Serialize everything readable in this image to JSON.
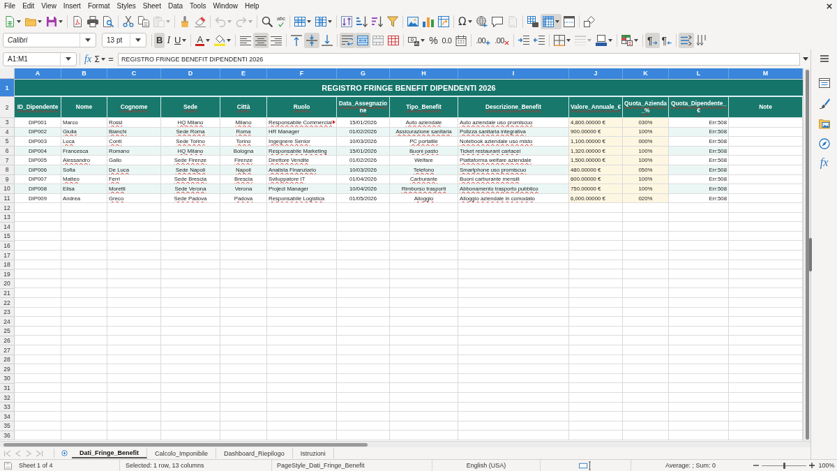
{
  "menu_bar": [
    "File",
    "Edit",
    "View",
    "Insert",
    "Format",
    "Styles",
    "Sheet",
    "Data",
    "Tools",
    "Window",
    "Help"
  ],
  "standard_toolbar": {
    "paste_disabled": true,
    "undo_disabled": true,
    "redo_disabled": true,
    "spelling_label": "abc",
    "special_character_label": "Ω",
    "header_footer_disabled": true,
    "freeze_rows_columns": true
  },
  "formatting_toolbar": {
    "font_name": "Calibri",
    "font_size": "13 pt",
    "bold": {
      "label": "B",
      "on": true
    },
    "italic": {
      "label": "I",
      "on": false
    },
    "underline": {
      "label": "U",
      "on": false
    },
    "font_color_label": "A",
    "align_left": false,
    "align_center": true,
    "align_right": false,
    "align_top": false,
    "align_middle": true,
    "align_bottom": false,
    "wrap_text": true,
    "merge_and_center": true,
    "percent_label": "%",
    "number_label": "0.0",
    "add_decimal_label": ".00",
    "delete_decimal_label": ".00",
    "border_style_disabled": true,
    "left_to_right": {
      "label": "¶",
      "on": true
    },
    "right_to_left": {
      "label": "¶",
      "on": false
    },
    "text_left_to_right": true,
    "text_top_to_bottom": false
  },
  "formula_bar": {
    "name_box": "A1:M1",
    "function_wizard_label": "fx",
    "sum_label": "Σ",
    "formula_label": "=",
    "value": "REGISTRO FRINGE BENEFIT DIPENDENTI 2026"
  },
  "sheet": {
    "column_headers": [
      {
        "label": "A",
        "selected": true
      },
      {
        "label": "B",
        "selected": true
      },
      {
        "label": "C",
        "selected": true
      },
      {
        "label": "D",
        "selected": true
      },
      {
        "label": "E",
        "selected": true
      },
      {
        "label": "F",
        "selected": true
      },
      {
        "label": "G",
        "selected": true
      },
      {
        "label": "H",
        "selected": true
      },
      {
        "label": "I",
        "selected": true
      },
      {
        "label": "J",
        "selected": true
      },
      {
        "label": "K",
        "selected": true
      },
      {
        "label": "L",
        "selected": true
      },
      {
        "label": "M",
        "selected": true
      }
    ],
    "row_headers": [
      {
        "label": "1",
        "selected": true
      },
      {
        "label": "2",
        "selected": false
      },
      {
        "label": "3",
        "selected": false
      },
      {
        "label": "4",
        "selected": false
      },
      {
        "label": "5",
        "selected": false
      },
      {
        "label": "6",
        "selected": false
      },
      {
        "label": "7",
        "selected": false
      },
      {
        "label": "8",
        "selected": false
      },
      {
        "label": "9",
        "selected": false
      },
      {
        "label": "10",
        "selected": false
      },
      {
        "label": "11",
        "selected": false
      },
      {
        "label": "12",
        "selected": false
      },
      {
        "label": "13",
        "selected": false
      },
      {
        "label": "14",
        "selected": false
      },
      {
        "label": "15",
        "selected": false
      },
      {
        "label": "16",
        "selected": false
      },
      {
        "label": "17",
        "selected": false
      },
      {
        "label": "18",
        "selected": false
      },
      {
        "label": "19",
        "selected": false
      },
      {
        "label": "20",
        "selected": false
      },
      {
        "label": "21",
        "selected": false
      },
      {
        "label": "22",
        "selected": false
      },
      {
        "label": "23",
        "selected": false
      },
      {
        "label": "24",
        "selected": false
      },
      {
        "label": "25",
        "selected": false
      },
      {
        "label": "26",
        "selected": false
      },
      {
        "label": "27",
        "selected": false
      },
      {
        "label": "28",
        "selected": false
      },
      {
        "label": "29",
        "selected": false
      },
      {
        "label": "30",
        "selected": false
      },
      {
        "label": "31",
        "selected": false
      },
      {
        "label": "32",
        "selected": false
      },
      {
        "label": "33",
        "selected": false
      },
      {
        "label": "34",
        "selected": false
      },
      {
        "label": "35",
        "selected": false
      },
      {
        "label": "36",
        "selected": false
      }
    ],
    "title": "REGISTRO FRINGE BENEFIT DIPENDENTI 2026",
    "header_row": [
      {
        "text": "ID_Dipendente",
        "misspelled": true
      },
      {
        "text": "Nome",
        "misspelled": false
      },
      {
        "text": "Cognome",
        "misspelled": true
      },
      {
        "text": "Sede",
        "misspelled": true
      },
      {
        "text": "Città",
        "misspelled": true
      },
      {
        "text": "Ruolo",
        "misspelled": true
      },
      {
        "text": "Data_Assegnazione",
        "misspelled": true
      },
      {
        "text": "Tipo_Benefit",
        "misspelled": true
      },
      {
        "text": "Descrizione_Benefit",
        "misspelled": true
      },
      {
        "text": "Valore_Annuale_€",
        "misspelled": true
      },
      {
        "text": "Quota_Azienda_%",
        "misspelled": true
      },
      {
        "text": "Quota_Dipendente_€",
        "misspelled": true
      },
      {
        "text": "Note",
        "misspelled": false
      }
    ],
    "data_rows": [
      [
        {
          "text": "DIP001",
          "misspelled": false,
          "clipped": false
        },
        {
          "text": "Marco",
          "misspelled": false,
          "clipped": false
        },
        {
          "text": "Rossi",
          "misspelled": true,
          "clipped": false
        },
        {
          "text": "HQ Milano",
          "misspelled": true,
          "clipped": false
        },
        {
          "text": "Milano",
          "misspelled": true,
          "clipped": false
        },
        {
          "text": "Responsabile Commercial",
          "misspelled": true,
          "clipped": true
        },
        {
          "text": "15/01/2026",
          "misspelled": false,
          "clipped": false
        },
        {
          "text": "Auto aziendale",
          "misspelled": true,
          "clipped": false
        },
        {
          "text": "Auto aziendale uso promiscuo",
          "misspelled": true,
          "clipped": false
        },
        {
          "text": "4,800.00000 €",
          "misspelled": false,
          "clipped": false
        },
        {
          "text": "030%",
          "misspelled": false,
          "clipped": false
        },
        {
          "text": "Err:508",
          "misspelled": false,
          "clipped": false
        }
      ],
      [
        {
          "text": "DIP002",
          "misspelled": false,
          "clipped": false
        },
        {
          "text": "Giulia",
          "misspelled": true,
          "clipped": false
        },
        {
          "text": "Bianchi",
          "misspelled": true,
          "clipped": false
        },
        {
          "text": "Sede Roma",
          "misspelled": true,
          "clipped": false
        },
        {
          "text": "Roma",
          "misspelled": true,
          "clipped": false
        },
        {
          "text": "HR Manager",
          "misspelled": false,
          "clipped": false
        },
        {
          "text": "01/02/2026",
          "misspelled": false,
          "clipped": false
        },
        {
          "text": "Assicurazione sanitaria",
          "misspelled": true,
          "clipped": false
        },
        {
          "text": "Polizza sanitaria integrativa",
          "misspelled": true,
          "clipped": false
        },
        {
          "text": "900.00000 €",
          "misspelled": false,
          "clipped": false
        },
        {
          "text": "100%",
          "misspelled": false,
          "clipped": false
        },
        {
          "text": "Err:508",
          "misspelled": false,
          "clipped": false
        }
      ],
      [
        {
          "text": "DIP003",
          "misspelled": false,
          "clipped": false
        },
        {
          "text": "Luca",
          "misspelled": true,
          "clipped": false
        },
        {
          "text": "Conti",
          "misspelled": true,
          "clipped": false
        },
        {
          "text": "Sede Torino",
          "misspelled": true,
          "clipped": false
        },
        {
          "text": "Torino",
          "misspelled": true,
          "clipped": false
        },
        {
          "text": "Ingegnere Senior",
          "misspelled": true,
          "clipped": false
        },
        {
          "text": "10/03/2026",
          "misspelled": false,
          "clipped": false
        },
        {
          "text": "PC portatile",
          "misspelled": true,
          "clipped": false
        },
        {
          "text": "Notebook aziendale uso misto",
          "misspelled": true,
          "clipped": false
        },
        {
          "text": "1,100.00000 €",
          "misspelled": false,
          "clipped": false
        },
        {
          "text": "000%",
          "misspelled": false,
          "clipped": false
        },
        {
          "text": "Err:508",
          "misspelled": false,
          "clipped": false
        }
      ],
      [
        {
          "text": "DIP004",
          "misspelled": false,
          "clipped": false
        },
        {
          "text": "Francesca",
          "misspelled": false,
          "clipped": false
        },
        {
          "text": "Romano",
          "misspelled": false,
          "clipped": false
        },
        {
          "text": "HQ Milano",
          "misspelled": true,
          "clipped": false
        },
        {
          "text": "Bologna",
          "misspelled": false,
          "clipped": false
        },
        {
          "text": "Responsabile Marketing",
          "misspelled": true,
          "clipped": false
        },
        {
          "text": "15/01/2026",
          "misspelled": false,
          "clipped": false
        },
        {
          "text": "Buoni pasto",
          "misspelled": true,
          "clipped": false
        },
        {
          "text": "Ticket restaurant cartacei",
          "misspelled": true,
          "clipped": false
        },
        {
          "text": "1,320.00000 €",
          "misspelled": false,
          "clipped": false
        },
        {
          "text": "100%",
          "misspelled": false,
          "clipped": false
        },
        {
          "text": "Err:508",
          "misspelled": false,
          "clipped": false
        }
      ],
      [
        {
          "text": "DIP005",
          "misspelled": false,
          "clipped": false
        },
        {
          "text": "Alessandro",
          "misspelled": true,
          "clipped": false
        },
        {
          "text": "Gallo",
          "misspelled": false,
          "clipped": false
        },
        {
          "text": "Sede Firenze",
          "misspelled": true,
          "clipped": false
        },
        {
          "text": "Firenze",
          "misspelled": true,
          "clipped": false
        },
        {
          "text": "Direttore Vendite",
          "misspelled": true,
          "clipped": false
        },
        {
          "text": "01/02/2026",
          "misspelled": false,
          "clipped": false
        },
        {
          "text": "Welfare",
          "misspelled": false,
          "clipped": false
        },
        {
          "text": "Piattaforma welfare aziendale",
          "misspelled": true,
          "clipped": false
        },
        {
          "text": "1,500.00000 €",
          "misspelled": false,
          "clipped": false
        },
        {
          "text": "100%",
          "misspelled": false,
          "clipped": false
        },
        {
          "text": "Err:508",
          "misspelled": false,
          "clipped": false
        }
      ],
      [
        {
          "text": "DIP006",
          "misspelled": false,
          "clipped": false
        },
        {
          "text": "Sofia",
          "misspelled": false,
          "clipped": false
        },
        {
          "text": "De Luca",
          "misspelled": true,
          "clipped": false
        },
        {
          "text": "Sede Napoli",
          "misspelled": true,
          "clipped": false
        },
        {
          "text": "Napoli",
          "misspelled": true,
          "clipped": false
        },
        {
          "text": "Analista Finanziario",
          "misspelled": true,
          "clipped": false
        },
        {
          "text": "10/03/2026",
          "misspelled": false,
          "clipped": false
        },
        {
          "text": "Telefono",
          "misspelled": true,
          "clipped": false
        },
        {
          "text": "Smartphone uso promiscuo",
          "misspelled": true,
          "clipped": false
        },
        {
          "text": "480.00000 €",
          "misspelled": false,
          "clipped": false
        },
        {
          "text": "050%",
          "misspelled": false,
          "clipped": false
        },
        {
          "text": "Err:508",
          "misspelled": false,
          "clipped": false
        }
      ],
      [
        {
          "text": "DIP007",
          "misspelled": false,
          "clipped": false
        },
        {
          "text": "Matteo",
          "misspelled": true,
          "clipped": false
        },
        {
          "text": "Ferri",
          "misspelled": true,
          "clipped": false
        },
        {
          "text": "Sede Brescia",
          "misspelled": true,
          "clipped": false
        },
        {
          "text": "Brescia",
          "misspelled": true,
          "clipped": false
        },
        {
          "text": "Sviluppatore IT",
          "misspelled": true,
          "clipped": false
        },
        {
          "text": "01/04/2026",
          "misspelled": false,
          "clipped": false
        },
        {
          "text": "Carburante",
          "misspelled": true,
          "clipped": false
        },
        {
          "text": "Buoni carburante mensili",
          "misspelled": true,
          "clipped": false
        },
        {
          "text": "600.00000 €",
          "misspelled": false,
          "clipped": false
        },
        {
          "text": "100%",
          "misspelled": false,
          "clipped": false
        },
        {
          "text": "Err:508",
          "misspelled": false,
          "clipped": false
        }
      ],
      [
        {
          "text": "DIP008",
          "misspelled": false,
          "clipped": false
        },
        {
          "text": "Elisa",
          "misspelled": false,
          "clipped": false
        },
        {
          "text": "Moretti",
          "misspelled": true,
          "clipped": false
        },
        {
          "text": "Sede Verona",
          "misspelled": true,
          "clipped": false
        },
        {
          "text": "Verona",
          "misspelled": false,
          "clipped": false
        },
        {
          "text": "Project Manager",
          "misspelled": false,
          "clipped": false
        },
        {
          "text": "10/04/2026",
          "misspelled": false,
          "clipped": false
        },
        {
          "text": "Rimborso trasporti",
          "misspelled": true,
          "clipped": false
        },
        {
          "text": "Abbonamento trasporto pubblico",
          "misspelled": true,
          "clipped": false
        },
        {
          "text": "750.00000 €",
          "misspelled": false,
          "clipped": false
        },
        {
          "text": "100%",
          "misspelled": false,
          "clipped": false
        },
        {
          "text": "Err:508",
          "misspelled": false,
          "clipped": false
        }
      ],
      [
        {
          "text": "DIP009",
          "misspelled": false,
          "clipped": false
        },
        {
          "text": "Andrea",
          "misspelled": false,
          "clipped": false
        },
        {
          "text": "Greco",
          "misspelled": true,
          "clipped": false
        },
        {
          "text": "Sede Padova",
          "misspelled": true,
          "clipped": false
        },
        {
          "text": "Padova",
          "misspelled": true,
          "clipped": false
        },
        {
          "text": "Responsabile Logistica",
          "misspelled": true,
          "clipped": false
        },
        {
          "text": "01/05/2026",
          "misspelled": false,
          "clipped": false
        },
        {
          "text": "Alloggio",
          "misspelled": true,
          "clipped": false
        },
        {
          "text": "Alloggio aziendale in comodato",
          "misspelled": true,
          "clipped": false
        },
        {
          "text": "6,000.00000 €",
          "misspelled": false,
          "clipped": false
        },
        {
          "text": "020%",
          "misspelled": false,
          "clipped": false
        },
        {
          "text": "Err:508",
          "misspelled": false,
          "clipped": false
        }
      ]
    ]
  },
  "sheet_tabs": [
    {
      "label": "Dati_Fringe_Benefit",
      "selected": true
    },
    {
      "label": "Calcolo_Imponibile",
      "selected": false
    },
    {
      "label": "Dashboard_Riepilogo",
      "selected": false
    },
    {
      "label": "Istruzioni",
      "selected": false
    }
  ],
  "sidebar": {
    "functions_label": "fx"
  },
  "status_bar": {
    "sheet": "Sheet 1 of 4",
    "selection": "Selected: 1 row, 13 columns",
    "page_style": "PageStyle_Dati_Fringe_Benefit",
    "language": "English (USA)",
    "summary": "Average: ; Sum: 0",
    "zoom": {
      "level": 0.5,
      "reading": "100%"
    }
  }
}
